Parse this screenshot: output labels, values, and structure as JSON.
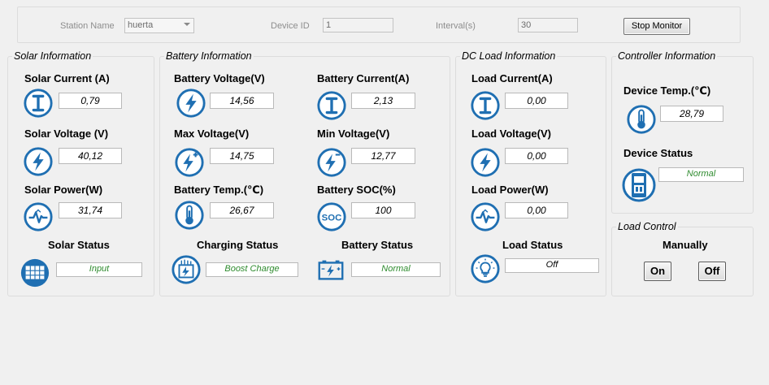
{
  "top": {
    "station_label": "Station Name",
    "station_value": "huerta",
    "device_label": "Device ID",
    "device_value": "1",
    "interval_label": "Interval(s)",
    "interval_value": "30",
    "stop_label": "Stop Monitor"
  },
  "solar": {
    "title": "Solar Information",
    "current_label": "Solar Current (A)",
    "current_value": "0,79",
    "voltage_label": "Solar Voltage (V)",
    "voltage_value": "40,12",
    "power_label": "Solar Power(W)",
    "power_value": "31,74",
    "status_label": "Solar Status",
    "status_value": "Input"
  },
  "battery": {
    "title": "Battery Information",
    "voltage_label": "Battery Voltage(V)",
    "voltage_value": "14,56",
    "current_label": "Battery Current(A)",
    "current_value": "2,13",
    "max_label": "Max Voltage(V)",
    "max_value": "14,75",
    "min_label": "Min Voltage(V)",
    "min_value": "12,77",
    "temp_label": "Battery Temp.(℃)",
    "temp_value": "26,67",
    "soc_label": "Battery SOC(%)",
    "soc_value": "100",
    "charging_label": "Charging Status",
    "charging_value": "Boost Charge",
    "status_label": "Battery Status",
    "status_value": "Normal"
  },
  "load": {
    "title": "DC Load Information",
    "current_label": "Load Current(A)",
    "current_value": "0,00",
    "voltage_label": "Load Voltage(V)",
    "voltage_value": "0,00",
    "power_label": "Load Power(W)",
    "power_value": "0,00",
    "status_label": "Load Status",
    "status_value": "Off"
  },
  "controller": {
    "title": "Controller Information",
    "temp_label": "Device Temp.(℃)",
    "temp_value": "28,79",
    "status_label": "Device Status",
    "status_value": "Normal"
  },
  "load_control": {
    "title": "Load Control",
    "mode_label": "Manually",
    "on_label": "On",
    "off_label": "Off"
  },
  "colors": {
    "icon_blue": "#1f6fb2",
    "status_green": "#2e8b2e"
  }
}
